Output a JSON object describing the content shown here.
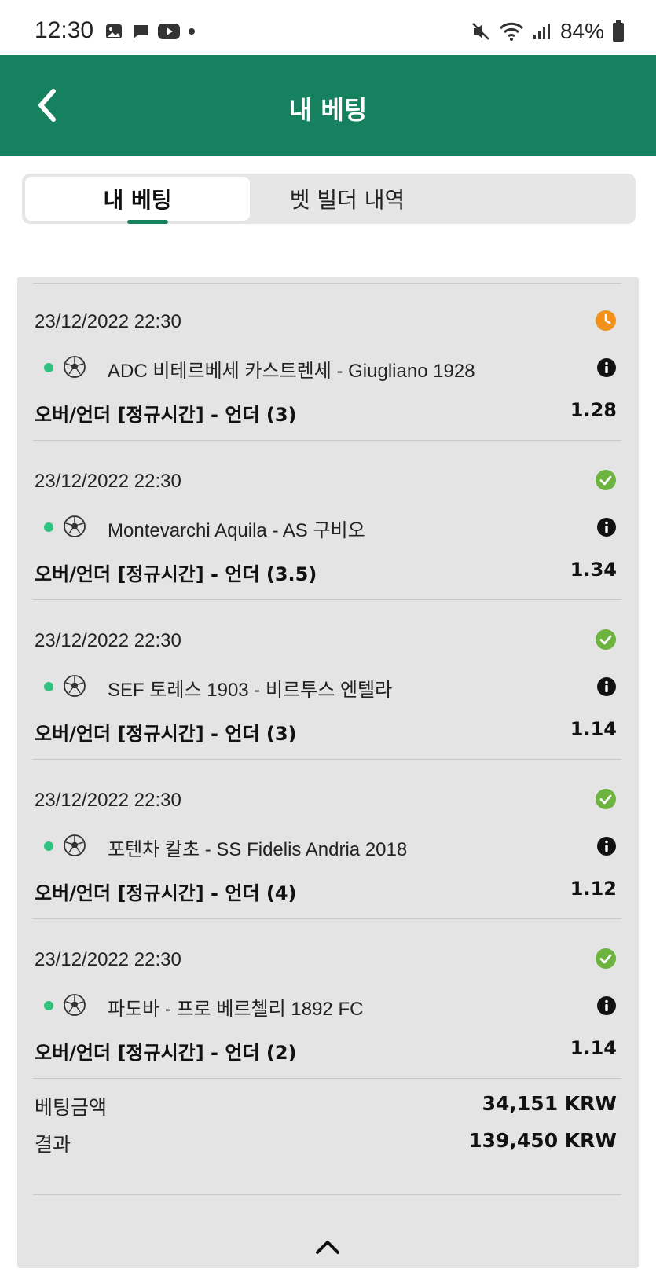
{
  "status_bar": {
    "time": "12:30",
    "battery": "84%"
  },
  "header": {
    "title": "내 베팅"
  },
  "tabs": [
    {
      "label": "내 베팅"
    },
    {
      "label": "벳 빌더 내역"
    }
  ],
  "colors": {
    "brand": "#16815e",
    "pending": "#f2921a",
    "won": "#6cb33f",
    "live_dot": "#2ec27e"
  },
  "bets": [
    {
      "date": "23/12/2022 22:30",
      "status": "pending",
      "status_icon": "clock-icon",
      "match": "ADC 비테르베세 카스트렌세 - Giugliano 1928",
      "market": "오버/언더 [정규시간] - 언더 (3)",
      "odds": "1.28"
    },
    {
      "date": "23/12/2022 22:30",
      "status": "won",
      "status_icon": "check-icon",
      "match": "Montevarchi Aquila - AS 구비오",
      "market": "오버/언더 [정규시간] - 언더 (3.5)",
      "odds": "1.34"
    },
    {
      "date": "23/12/2022 22:30",
      "status": "won",
      "status_icon": "check-icon",
      "match": "SEF 토레스 1903 - 비르투스 엔텔라",
      "market": "오버/언더 [정규시간] - 언더 (3)",
      "odds": "1.14"
    },
    {
      "date": "23/12/2022 22:30",
      "status": "won",
      "status_icon": "check-icon",
      "match": "포텐차 칼초 - SS Fidelis Andria 2018",
      "market": "오버/언더 [정규시간] - 언더 (4)",
      "odds": "1.12"
    },
    {
      "date": "23/12/2022 22:30",
      "status": "won",
      "status_icon": "check-icon",
      "match": "파도바 - 프로 베르첼리 1892 FC",
      "market": "오버/언더 [정규시간] - 언더 (2)",
      "odds": "1.14"
    }
  ],
  "summary": {
    "stake_label": "베팅금액",
    "stake_value": "34,151 KRW",
    "result_label": "결과",
    "result_value": "139,450 KRW"
  }
}
